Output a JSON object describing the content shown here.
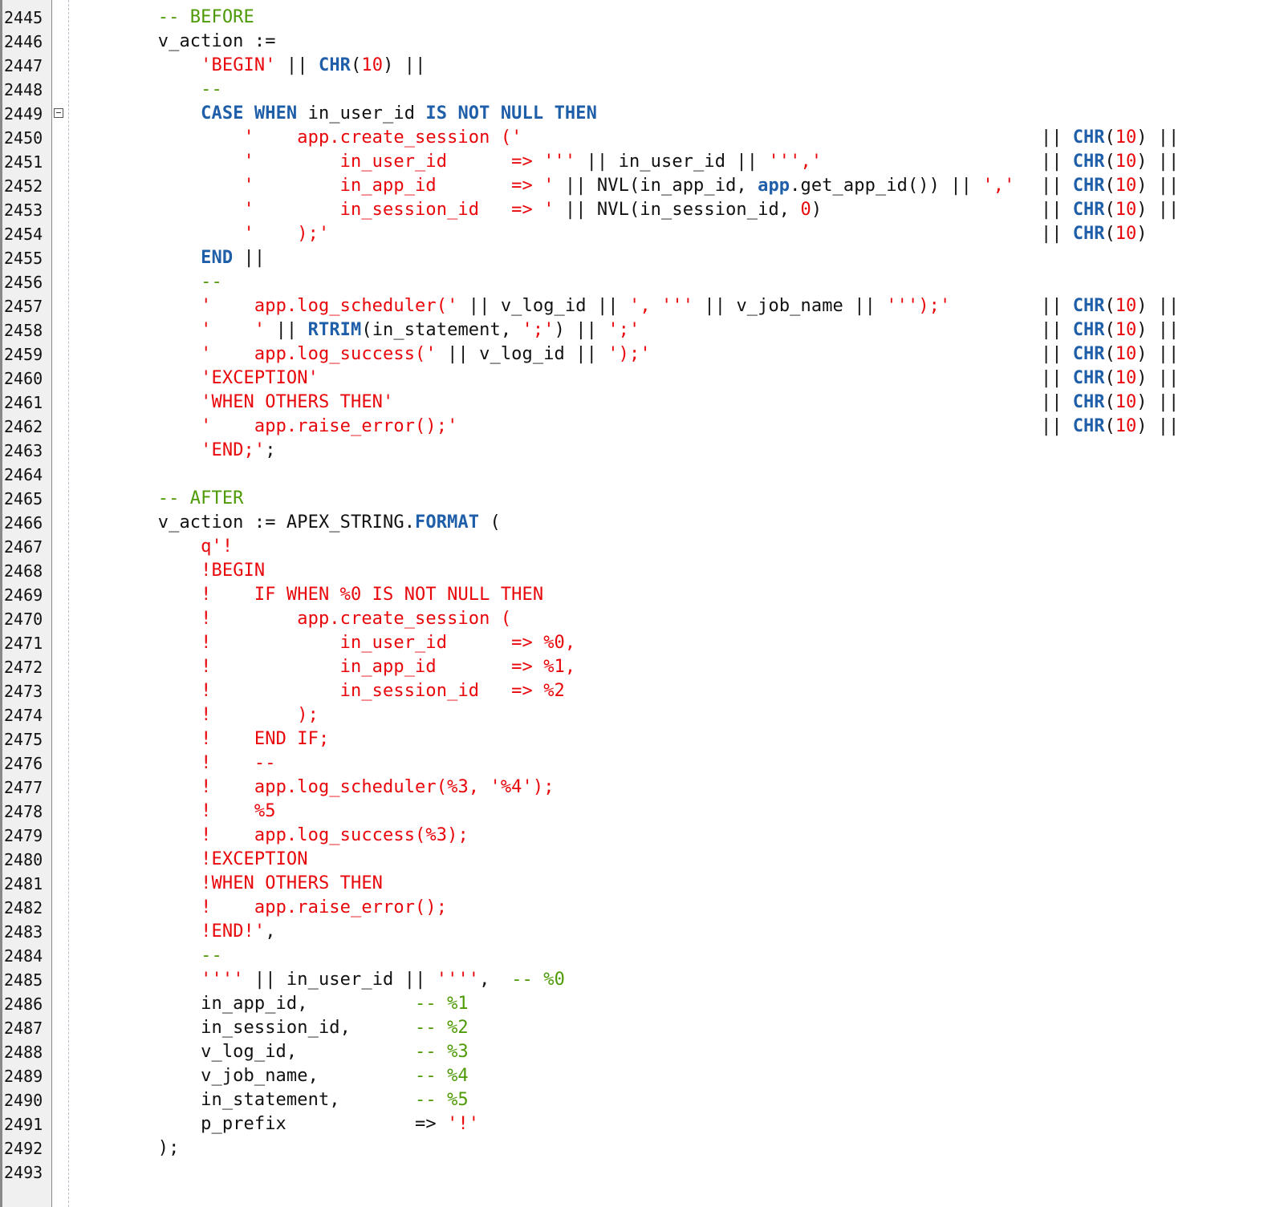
{
  "editor": {
    "fold_icon": "minus-box-icon",
    "colors": {
      "string": "#e8060b",
      "keyword": "#1f5ea8",
      "comment": "#4e9a06",
      "plain": "#111111",
      "gutter_bg": "#f0f0f0"
    },
    "lines": [
      {
        "n": "2445",
        "segs": [
          [
            "        ",
            "p"
          ],
          [
            "-- BEFORE",
            "c"
          ]
        ]
      },
      {
        "n": "2446",
        "segs": [
          [
            "        v_action :=",
            "p"
          ]
        ]
      },
      {
        "n": "2447",
        "segs": [
          [
            "            ",
            "p"
          ],
          [
            "'BEGIN'",
            "s"
          ],
          [
            " || ",
            "p"
          ],
          [
            "CHR",
            "k"
          ],
          [
            "(",
            "p"
          ],
          [
            "10",
            "n"
          ],
          [
            ") ||",
            "p"
          ]
        ]
      },
      {
        "n": "2448",
        "segs": [
          [
            "            ",
            "p"
          ],
          [
            "--",
            "c"
          ]
        ]
      },
      {
        "n": "2449",
        "fold": true,
        "segs": [
          [
            "            ",
            "p"
          ],
          [
            "CASE WHEN",
            "k"
          ],
          [
            " in_user_id ",
            "p"
          ],
          [
            "IS NOT NULL THEN",
            "k"
          ]
        ]
      },
      {
        "n": "2450",
        "segs": [
          [
            "                ",
            "p"
          ],
          [
            "'    app.create_session ('",
            "s"
          ]
        ],
        "right": true
      },
      {
        "n": "2451",
        "segs": [
          [
            "                ",
            "p"
          ],
          [
            "'        in_user_id      => '''",
            "s"
          ],
          [
            " || in_user_id || ",
            "p"
          ],
          [
            "''','",
            "s"
          ]
        ],
        "right": true
      },
      {
        "n": "2452",
        "segs": [
          [
            "                ",
            "p"
          ],
          [
            "'        in_app_id       => '",
            "s"
          ],
          [
            " || NVL(in_app_id, ",
            "p"
          ],
          [
            "app",
            "k"
          ],
          [
            ".get_app_id()) || ",
            "p"
          ],
          [
            "','",
            "s"
          ]
        ],
        "right": true
      },
      {
        "n": "2453",
        "segs": [
          [
            "                ",
            "p"
          ],
          [
            "'        in_session_id   => '",
            "s"
          ],
          [
            " || NVL(in_session_id, ",
            "p"
          ],
          [
            "0",
            "n"
          ],
          [
            ")",
            "p"
          ]
        ],
        "right": true
      },
      {
        "n": "2454",
        "segs": [
          [
            "                ",
            "p"
          ],
          [
            "'    );'",
            "s"
          ]
        ],
        "right": true,
        "right_last": true
      },
      {
        "n": "2455",
        "segs": [
          [
            "            ",
            "p"
          ],
          [
            "END",
            "k"
          ],
          [
            " ||",
            "p"
          ]
        ]
      },
      {
        "n": "2456",
        "segs": [
          [
            "            ",
            "p"
          ],
          [
            "--",
            "c"
          ]
        ]
      },
      {
        "n": "2457",
        "segs": [
          [
            "            ",
            "p"
          ],
          [
            "'    app.log_scheduler('",
            "s"
          ],
          [
            " || v_log_id || ",
            "p"
          ],
          [
            "', '''",
            "s"
          ],
          [
            " || v_job_name || ",
            "p"
          ],
          [
            "''');'",
            "s"
          ]
        ],
        "right": true
      },
      {
        "n": "2458",
        "segs": [
          [
            "            ",
            "p"
          ],
          [
            "'    '",
            "s"
          ],
          [
            " || ",
            "p"
          ],
          [
            "RTRIM",
            "k"
          ],
          [
            "(in_statement, ",
            "p"
          ],
          [
            "';'",
            "s"
          ],
          [
            ") || ",
            "p"
          ],
          [
            "';'",
            "s"
          ]
        ],
        "right": true
      },
      {
        "n": "2459",
        "segs": [
          [
            "            ",
            "p"
          ],
          [
            "'    app.log_success('",
            "s"
          ],
          [
            " || v_log_id || ",
            "p"
          ],
          [
            "');'",
            "s"
          ]
        ],
        "right": true
      },
      {
        "n": "2460",
        "segs": [
          [
            "            ",
            "p"
          ],
          [
            "'EXCEPTION'",
            "s"
          ]
        ],
        "right": true
      },
      {
        "n": "2461",
        "segs": [
          [
            "            ",
            "p"
          ],
          [
            "'WHEN OTHERS THEN'",
            "s"
          ]
        ],
        "right": true
      },
      {
        "n": "2462",
        "segs": [
          [
            "            ",
            "p"
          ],
          [
            "'    app.raise_error();'",
            "s"
          ]
        ],
        "right": true
      },
      {
        "n": "2463",
        "segs": [
          [
            "            ",
            "p"
          ],
          [
            "'END;'",
            "s"
          ],
          [
            ";",
            "p"
          ]
        ]
      },
      {
        "n": "2464",
        "segs": []
      },
      {
        "n": "2465",
        "segs": [
          [
            "        ",
            "p"
          ],
          [
            "-- AFTER",
            "c"
          ]
        ]
      },
      {
        "n": "2466",
        "segs": [
          [
            "        v_action := APEX_STRING.",
            "p"
          ],
          [
            "FORMAT",
            "k"
          ],
          [
            " (",
            "p"
          ]
        ]
      },
      {
        "n": "2467",
        "segs": [
          [
            "            ",
            "p"
          ],
          [
            "q'!",
            "s"
          ]
        ]
      },
      {
        "n": "2468",
        "segs": [
          [
            "            ",
            "p"
          ],
          [
            "!BEGIN",
            "s"
          ]
        ]
      },
      {
        "n": "2469",
        "segs": [
          [
            "            ",
            "p"
          ],
          [
            "!    IF WHEN %0 IS NOT NULL THEN",
            "s"
          ]
        ]
      },
      {
        "n": "2470",
        "segs": [
          [
            "            ",
            "p"
          ],
          [
            "!        app.create_session (",
            "s"
          ]
        ]
      },
      {
        "n": "2471",
        "segs": [
          [
            "            ",
            "p"
          ],
          [
            "!            in_user_id      => %0,",
            "s"
          ]
        ]
      },
      {
        "n": "2472",
        "segs": [
          [
            "            ",
            "p"
          ],
          [
            "!            in_app_id       => %1,",
            "s"
          ]
        ]
      },
      {
        "n": "2473",
        "segs": [
          [
            "            ",
            "p"
          ],
          [
            "!            in_session_id   => %2",
            "s"
          ]
        ]
      },
      {
        "n": "2474",
        "segs": [
          [
            "            ",
            "p"
          ],
          [
            "!        );",
            "s"
          ]
        ]
      },
      {
        "n": "2475",
        "segs": [
          [
            "            ",
            "p"
          ],
          [
            "!    END IF;",
            "s"
          ]
        ]
      },
      {
        "n": "2476",
        "segs": [
          [
            "            ",
            "p"
          ],
          [
            "!    --",
            "s"
          ]
        ]
      },
      {
        "n": "2477",
        "segs": [
          [
            "            ",
            "p"
          ],
          [
            "!    app.log_scheduler(%3, '%4');",
            "s"
          ]
        ]
      },
      {
        "n": "2478",
        "segs": [
          [
            "            ",
            "p"
          ],
          [
            "!    %5",
            "s"
          ]
        ]
      },
      {
        "n": "2479",
        "segs": [
          [
            "            ",
            "p"
          ],
          [
            "!    app.log_success(%3);",
            "s"
          ]
        ]
      },
      {
        "n": "2480",
        "segs": [
          [
            "            ",
            "p"
          ],
          [
            "!EXCEPTION",
            "s"
          ]
        ]
      },
      {
        "n": "2481",
        "segs": [
          [
            "            ",
            "p"
          ],
          [
            "!WHEN OTHERS THEN",
            "s"
          ]
        ]
      },
      {
        "n": "2482",
        "segs": [
          [
            "            ",
            "p"
          ],
          [
            "!    app.raise_error();",
            "s"
          ]
        ]
      },
      {
        "n": "2483",
        "segs": [
          [
            "            ",
            "p"
          ],
          [
            "!END!'",
            "s"
          ],
          [
            ",",
            "p"
          ]
        ]
      },
      {
        "n": "2484",
        "segs": [
          [
            "            ",
            "p"
          ],
          [
            "--",
            "c"
          ]
        ]
      },
      {
        "n": "2485",
        "segs": [
          [
            "            ",
            "p"
          ],
          [
            "''''",
            "s"
          ],
          [
            " || in_user_id || ",
            "p"
          ],
          [
            "''''",
            "s"
          ],
          [
            ",  ",
            "p"
          ],
          [
            "-- %0",
            "c"
          ]
        ]
      },
      {
        "n": "2486",
        "segs": [
          [
            "            in_app_id,          ",
            "p"
          ],
          [
            "-- %1",
            "c"
          ]
        ]
      },
      {
        "n": "2487",
        "segs": [
          [
            "            in_session_id,      ",
            "p"
          ],
          [
            "-- %2",
            "c"
          ]
        ]
      },
      {
        "n": "2488",
        "segs": [
          [
            "            v_log_id,           ",
            "p"
          ],
          [
            "-- %3",
            "c"
          ]
        ]
      },
      {
        "n": "2489",
        "segs": [
          [
            "            v_job_name,         ",
            "p"
          ],
          [
            "-- %4",
            "c"
          ]
        ]
      },
      {
        "n": "2490",
        "segs": [
          [
            "            in_statement,       ",
            "p"
          ],
          [
            "-- %5",
            "c"
          ]
        ]
      },
      {
        "n": "2491",
        "segs": [
          [
            "            p_prefix            => ",
            "p"
          ],
          [
            "'!'",
            "s"
          ]
        ]
      },
      {
        "n": "2492",
        "segs": [
          [
            "        );",
            "p"
          ]
        ]
      },
      {
        "n": "2493",
        "segs": []
      }
    ],
    "right_concat": {
      "pipe_before": "|| ",
      "func": "CHR",
      "open": "(",
      "num": "10",
      "close": ")",
      "pipe_after": " ||"
    }
  }
}
